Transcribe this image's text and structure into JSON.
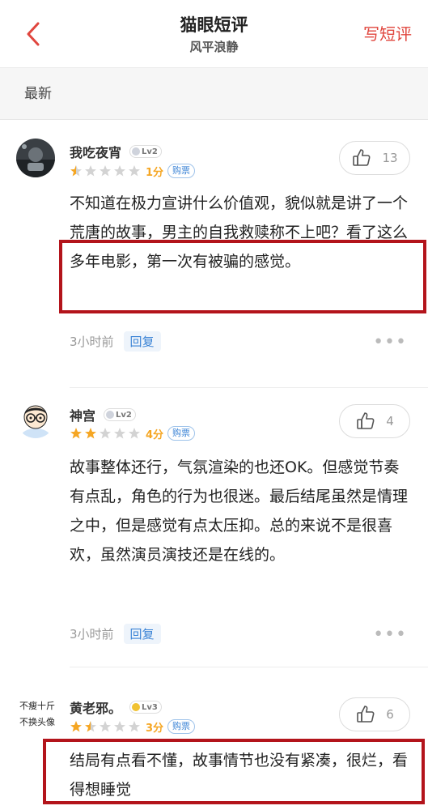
{
  "header": {
    "title": "猫眼短评",
    "subtitle": "风平浪静",
    "write_label": "写短评"
  },
  "sort": {
    "label": "最新"
  },
  "colors": {
    "accent": "#e0463e",
    "star": "#f5a623",
    "link": "#3c84d6",
    "highlight": "#b3141b"
  },
  "reviews": [
    {
      "avatar_text": "",
      "name": "我吃夜宵",
      "level": "Lv2",
      "stars": 0.5,
      "score_label": "1分",
      "ticket_label": "购票",
      "likes": "13",
      "content": "不知道在极力宣讲什么价值观，貌似就是讲了一个荒唐的故事，男主的自我救赎称不上吧？看了这么多年电影，第一次有被骗的感觉。",
      "time": "3小时前",
      "reply_label": "回复"
    },
    {
      "avatar_text": "",
      "name": "神宫",
      "level": "Lv2",
      "stars": 2,
      "score_label": "4分",
      "ticket_label": "购票",
      "likes": "4",
      "content": "故事整体还行，气氛渲染的也还OK。但感觉节奏有点乱，角色的行为也很迷。最后结尾虽然是情理之中，但是感觉有点太压抑。总的来说不是很喜欢，虽然演员演技还是在线的。",
      "time": "3小时前",
      "reply_label": "回复"
    },
    {
      "avatar_text_line1": "不瘦十斤",
      "avatar_text_line2": "不换头像",
      "name": "黄老邪。",
      "level": "Lv3",
      "stars": 1.5,
      "score_label": "3分",
      "ticket_label": "购票",
      "likes": "6",
      "content": "结局有点看不懂，故事情节也没有紧凑，很烂，看得想睡觉"
    }
  ]
}
